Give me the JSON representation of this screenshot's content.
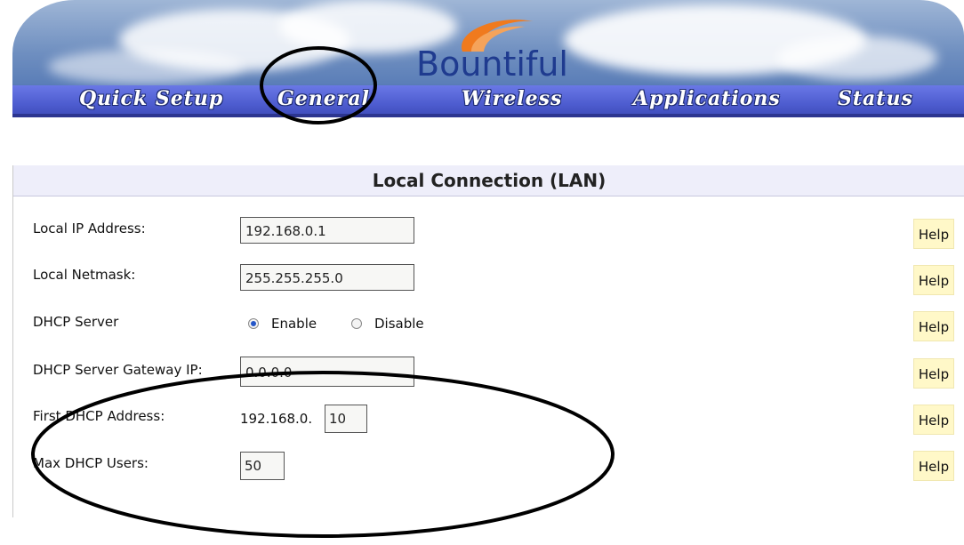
{
  "header": {
    "logo_text": "Bountiful",
    "nav": [
      {
        "label": "Quick Setup"
      },
      {
        "label": "General"
      },
      {
        "label": "Wireless"
      },
      {
        "label": "Applications"
      },
      {
        "label": "Status"
      }
    ]
  },
  "lan": {
    "title": "Local Connection (LAN)",
    "help_label": "Help",
    "local_ip": {
      "label": "Local IP Address:",
      "value": "192.168.0.1"
    },
    "netmask": {
      "label": "Local Netmask:",
      "value": "255.255.255.0"
    },
    "dhcp_server": {
      "label": "DHCP Server",
      "options": [
        "Enable",
        "Disable"
      ],
      "selected": "Enable"
    },
    "gateway": {
      "label": "DHCP Server Gateway IP:",
      "value": "0.0.0.0"
    },
    "first_dhcp": {
      "label": "First DHCP Address:",
      "prefix": "192.168.0.",
      "value": "10"
    },
    "max_users": {
      "label": "Max DHCP Users:",
      "value": "50"
    }
  },
  "colors": {
    "nav_bar": "#4d5ccf",
    "logo_blue": "#1f3b8f",
    "logo_orange": "#f07a1e",
    "help_bg": "#fff8c8",
    "panel_header_bg": "#eeeefa",
    "radio_selected": "#2456c8"
  },
  "icons": [
    "bountiful-logo-swoosh-icon",
    "radio-checked-icon",
    "radio-unchecked-icon"
  ]
}
